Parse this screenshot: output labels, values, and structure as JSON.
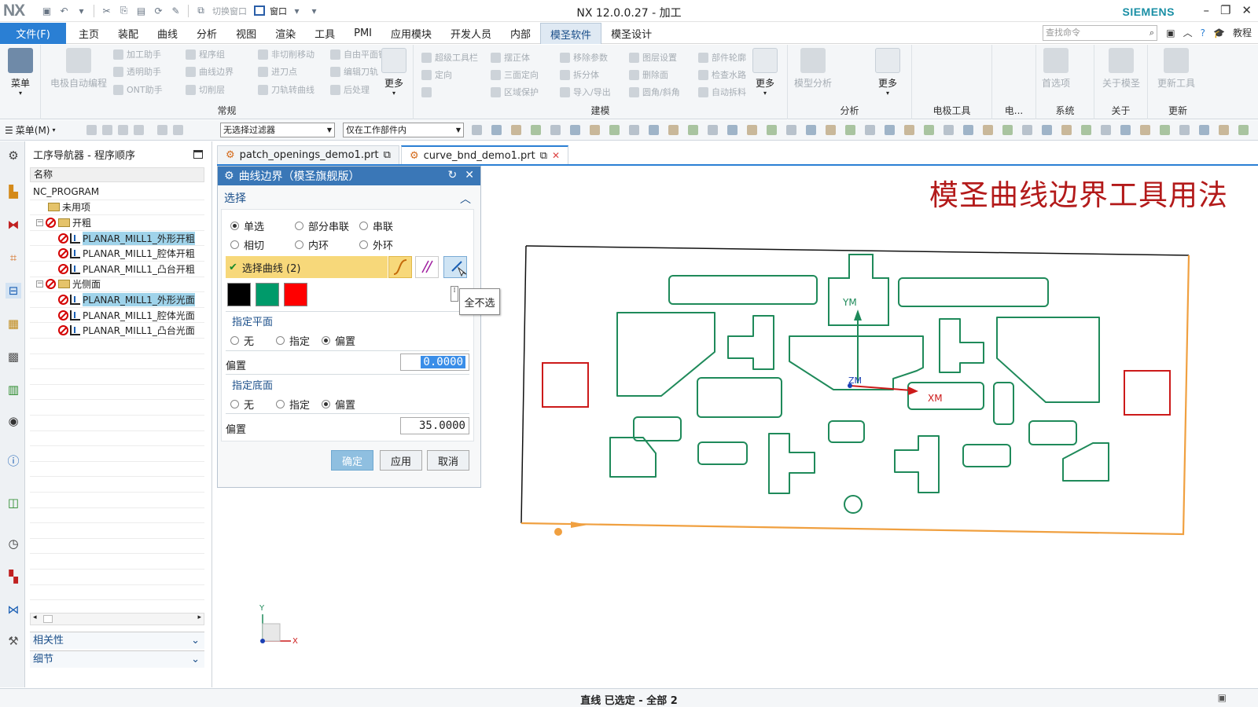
{
  "title_bar": {
    "logo": "NX",
    "quick_access_switch_window": "切换窗口",
    "quick_access_window": "窗口",
    "app_title": "NX 12.0.0.27 - 加工",
    "brand": "SIEMENS"
  },
  "menu": {
    "file_tab": "文件(F)",
    "tabs": [
      "主页",
      "装配",
      "曲线",
      "分析",
      "视图",
      "渲染",
      "工具",
      "PMI",
      "应用模块",
      "开发人员",
      "内部",
      "模圣软件",
      "模圣设计"
    ],
    "active_tab": "模圣软件",
    "search_placeholder": "查找命令",
    "tutorial": "教程"
  },
  "ribbon": {
    "menu_big": "菜单",
    "electrode_auto": "电极自动编程",
    "groups": {
      "changgui": "常规",
      "jianmo": "建模",
      "fenxi": "分析",
      "electrode": "电极工具",
      "dian": "电...",
      "system": "系统",
      "about": "关于",
      "update": "更新"
    },
    "changgui_items": [
      [
        "加工助手",
        "程序组",
        "非切削移动",
        "自由平面铣"
      ],
      [
        "透明助手",
        "曲线边界",
        "进刀点",
        "编辑刀轨"
      ],
      [
        "ONT助手",
        "切削层",
        "刀轨转曲线",
        "后处理"
      ]
    ],
    "jianmo_items": [
      [
        "超级工具栏",
        "摆正体",
        "移除参数",
        "图层设置",
        "部件轮廓"
      ],
      [
        "定向",
        "三面定向",
        "拆分体",
        "删除面",
        "检查水路"
      ],
      [
        "",
        "区域保护",
        "导入/导出",
        "圆角/斜角",
        "自动拆料"
      ]
    ],
    "more": "更多",
    "model_analysis": "模型分析",
    "preferences": "首选项",
    "about_mosheng": "关于模圣",
    "update_tool": "更新工具"
  },
  "toolbar2": {
    "menu_label": "菜单(M)",
    "filter": "无选择过滤器",
    "scope": "仅在工作部件内"
  },
  "navigator": {
    "title": "工序导航器 - 程序顺序",
    "column": "名称",
    "rows": [
      {
        "label": "NC_PROGRAM",
        "level": 0,
        "type": "root",
        "selected": false
      },
      {
        "label": "未用项",
        "level": 1,
        "type": "folder",
        "selected": false
      },
      {
        "label": "开粗",
        "level": 1,
        "type": "group",
        "selected": false
      },
      {
        "label": "PLANAR_MILL1_外形开粗",
        "level": 2,
        "type": "op",
        "selected": true
      },
      {
        "label": "PLANAR_MILL1_腔体开粗",
        "level": 2,
        "type": "op",
        "selected": false
      },
      {
        "label": "PLANAR_MILL1_凸台开粗",
        "level": 2,
        "type": "op",
        "selected": false
      },
      {
        "label": "光侧面",
        "level": 1,
        "type": "group",
        "selected": false
      },
      {
        "label": "PLANAR_MILL1_外形光面",
        "level": 2,
        "type": "op",
        "selected": true
      },
      {
        "label": "PLANAR_MILL1_腔体光面",
        "level": 2,
        "type": "op",
        "selected": false
      },
      {
        "label": "PLANAR_MILL1_凸台光面",
        "level": 2,
        "type": "op",
        "selected": false
      }
    ],
    "dependencies": "相关性",
    "details": "细节"
  },
  "doc_tabs": [
    {
      "label": "patch_openings_demo1.prt",
      "active": false
    },
    {
      "label": "curve_bnd_demo1.prt",
      "active": true
    }
  ],
  "dialog": {
    "title": "曲线边界（模圣旗舰版）",
    "section_select": "选择",
    "radios_row1": [
      "单选",
      "部分串联",
      "串联"
    ],
    "radios_row2": [
      "相切",
      "内环",
      "外环"
    ],
    "selected_radio": "单选",
    "select_curve": "选择曲线 (2)",
    "swatch_colors": [
      "#000000",
      "#009a6a",
      "#ff0000"
    ],
    "plane_head": "指定平面",
    "plane_opts": [
      "无",
      "指定",
      "偏置"
    ],
    "plane_selected": "偏置",
    "offset_label": "偏置",
    "offset1": "0.0000",
    "floor_head": "指定底面",
    "floor_opts": [
      "无",
      "指定",
      "偏置"
    ],
    "floor_selected": "偏置",
    "offset2": "35.0000",
    "ok": "确定",
    "apply": "应用",
    "cancel": "取消"
  },
  "tooltip": "全不选",
  "canvas": {
    "heading": "模圣曲线边界工具用法",
    "axis_ym": "YM",
    "axis_xm": "XM",
    "axis_zm": "ZM",
    "triad_y": "Y",
    "triad_x": "X",
    "colors": {
      "outline": "#1f8a5a",
      "red_boxes": "#cc1a1a",
      "orange_edge": "#f0a040"
    }
  },
  "status": {
    "text": "直线 已选定 - 全部 2"
  }
}
